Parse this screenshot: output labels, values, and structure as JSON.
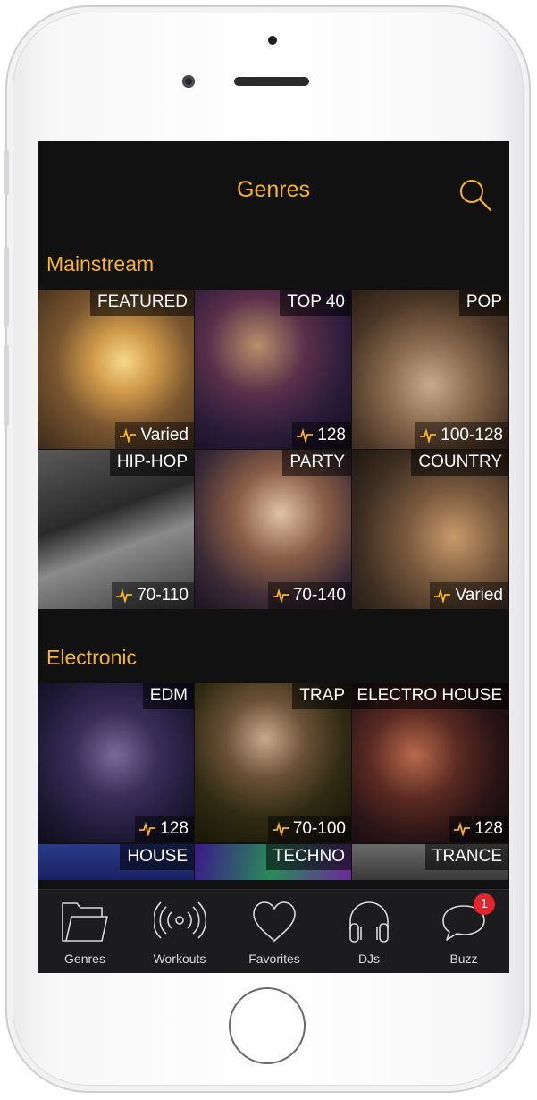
{
  "nav": {
    "title": "Genres"
  },
  "sections": [
    {
      "title": "Mainstream",
      "tiles": [
        {
          "name": "FEATURED",
          "bpm": "Varied"
        },
        {
          "name": "TOP 40",
          "bpm": "128"
        },
        {
          "name": "POP",
          "bpm": "100-128"
        },
        {
          "name": "HIP-HOP",
          "bpm": "70-110"
        },
        {
          "name": "PARTY",
          "bpm": "70-140"
        },
        {
          "name": "COUNTRY",
          "bpm": "Varied"
        }
      ]
    },
    {
      "title": "Electronic",
      "tiles": [
        {
          "name": "EDM",
          "bpm": "128"
        },
        {
          "name": "TRAP",
          "bpm": "70-100"
        },
        {
          "name": "ELECTRO HOUSE",
          "bpm": "128"
        },
        {
          "name": "HOUSE"
        },
        {
          "name": "TECHNO"
        },
        {
          "name": "TRANCE"
        }
      ]
    }
  ],
  "tabbar": {
    "items": [
      {
        "label": "Genres",
        "icon": "folder-icon"
      },
      {
        "label": "Workouts",
        "icon": "broadcast-icon"
      },
      {
        "label": "Favorites",
        "icon": "heart-icon"
      },
      {
        "label": "DJs",
        "icon": "headphones-icon"
      },
      {
        "label": "Buzz",
        "icon": "chat-bubble-icon",
        "badge": "1"
      }
    ]
  },
  "colors": {
    "accent": "#f5b42b",
    "badge": "#e3262c",
    "screen_bg": "#111111"
  }
}
